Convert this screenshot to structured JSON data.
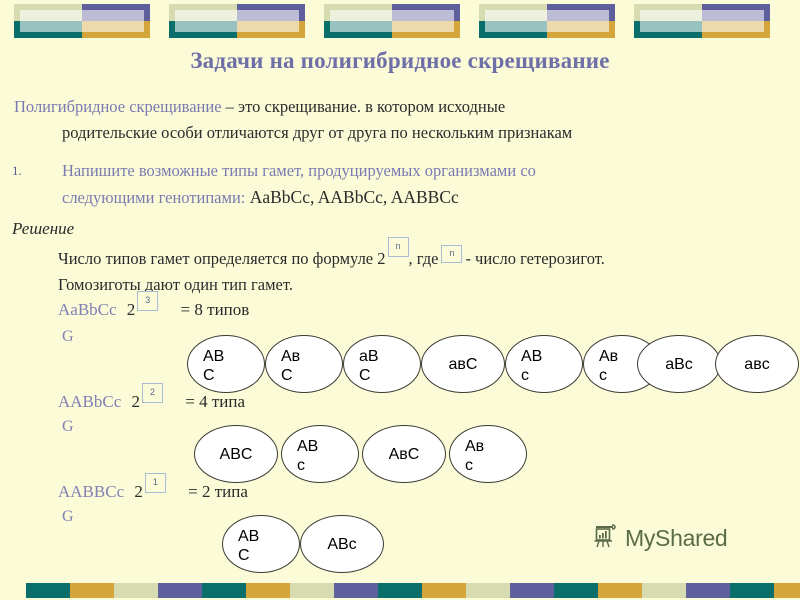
{
  "slide": {
    "background_color": "#fbfbd8",
    "title": "Задачи на полигибридное скрещивание",
    "title_color": "#6f6fa8"
  },
  "decor": {
    "top_colors": {
      "sage": "#d7dcb0",
      "purple": "#5f5f9e",
      "teal": "#0a6f6a",
      "gold": "#d4a53a"
    },
    "top_block_count": 5,
    "bottom_block_count": 9
  },
  "intro": {
    "term": "Полигибридное скрещивание",
    "line1_rest": " – это скрещивание. в котором исходные",
    "line2": "родительские особи отличаются друг от друга по нескольким признакам"
  },
  "item1": {
    "number": "1.",
    "line1": "Напишите возможные типы гамет, продуцируемых организмами со",
    "line2_purple": "следующими генотипами:",
    "line2_dark": " AaBbCc, AABbCc, AABBCc"
  },
  "solution": {
    "heading": "Решение",
    "formula_prefix": "Число типов гамет определяется по формуле 2",
    "formula_exp": "n",
    "formula_mid": ", где",
    "formula_var": "n",
    "formula_suffix": "- число гетерозигот.",
    "formula_line2": "Гомозиготы дают один тип гамет."
  },
  "cases": [
    {
      "genotype": "AaBbCc",
      "base": "2",
      "exponent": "3",
      "result": "= 8 типов",
      "gamete_label": "G",
      "gametes": [
        {
          "line1": "AB",
          "line2": "C"
        },
        {
          "line1": "Aв",
          "line2": "C"
        },
        {
          "line1": "aB",
          "line2": "C"
        },
        {
          "line1": "aвC",
          "line2": ""
        },
        {
          "line1": "AB",
          "line2": "с"
        },
        {
          "line1": "Aв",
          "line2": "с"
        },
        {
          "line1": "aBc",
          "line2": ""
        },
        {
          "line1": "aвc",
          "line2": ""
        }
      ]
    },
    {
      "genotype": "AABbCc",
      "base": "2",
      "exponent": "2",
      "result": "= 4 типа",
      "gamete_label": "G",
      "gametes": [
        {
          "line1": "ABC",
          "line2": ""
        },
        {
          "line1": "AB",
          "line2": "с"
        },
        {
          "line1": "AвC",
          "line2": ""
        },
        {
          "line1": "Aв",
          "line2": "с"
        }
      ]
    },
    {
      "genotype": "AABBCc",
      "base": "2",
      "exponent": "1",
      "result": "= 2 типа",
      "gamete_label": "G",
      "gametes": [
        {
          "line1": "AB",
          "line2": "C"
        },
        {
          "line1": "ABc",
          "line2": ""
        }
      ]
    }
  ],
  "watermark": {
    "text": "MyShared",
    "icon": "presentation-chart-icon",
    "color": "#5b6b4a"
  }
}
